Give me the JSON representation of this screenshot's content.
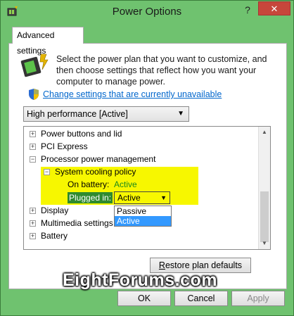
{
  "window": {
    "title": "Power Options",
    "help": "?",
    "close": "✕"
  },
  "tabs": [
    {
      "label": "Advanced settings"
    }
  ],
  "intro": {
    "text": "Select the power plan that you want to customize, and then choose settings that reflect how you want your computer to manage power.",
    "change_link": "Change settings that are currently unavailable"
  },
  "plan": {
    "selected": "High performance [Active]"
  },
  "tree": {
    "items": [
      {
        "label": "Power buttons and lid",
        "expander": "+"
      },
      {
        "label": "PCI Express",
        "expander": "+"
      },
      {
        "label": "Processor power management",
        "expander": "−"
      },
      {
        "label": "System cooling policy",
        "expander": "−"
      },
      {
        "label": "On battery:",
        "value": "Active"
      },
      {
        "label": "Plugged in:"
      },
      {
        "label": "Display",
        "expander": "+"
      },
      {
        "label": "Multimedia settings",
        "expander": "+"
      },
      {
        "label": "Battery",
        "expander": "+"
      }
    ],
    "plugged_in": {
      "selected": "Active",
      "options": [
        "Passive",
        "Active"
      ]
    }
  },
  "buttons": {
    "restore": "Restore plan defaults",
    "restore_accel": "R",
    "restore_rest": "estore plan defaults",
    "ok": "OK",
    "cancel": "Cancel",
    "apply": "Apply"
  },
  "watermark": "EightForums.com",
  "colors": {
    "highlight": "#f7f700",
    "link": "#0066cc",
    "selection": "#3399ff",
    "close": "#c7463b"
  }
}
